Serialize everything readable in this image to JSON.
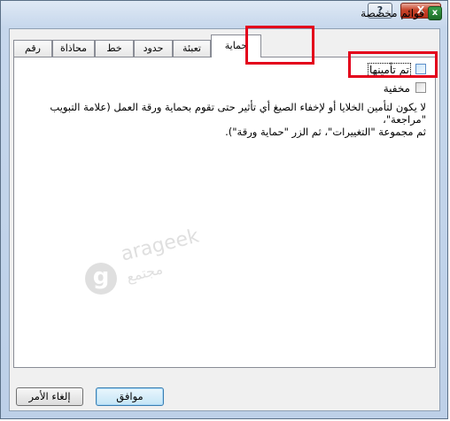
{
  "window": {
    "title": "قوائم مخصصة",
    "help_label": "?",
    "close_label": "X"
  },
  "tabs": [
    {
      "label": "رقم"
    },
    {
      "label": "محاذاة"
    },
    {
      "label": "خط"
    },
    {
      "label": "حدود"
    },
    {
      "label": "تعبئة"
    },
    {
      "label": "حماية",
      "active": true
    }
  ],
  "protection": {
    "locked_label": "تم تأمينها",
    "locked_checked": false,
    "hidden_label": "مخفية",
    "hidden_checked": false,
    "note_line1": "لا يكون لتأمين الخلايا أو لإخفاء الصيغ أي تأثير حتى تقوم بحماية ورقة العمل (علامة التبويب \"مراجعة\"،",
    "note_line2": "ثم مجموعة \"التغييرات\"، ثم الزر \"حماية ورقة\")."
  },
  "watermark": {
    "logo_letter": "g",
    "brand": "arageek",
    "sub": "مجتمع"
  },
  "buttons": {
    "ok_label": "موافق",
    "cancel_label": "إلغاء الأمر"
  },
  "colors": {
    "highlight": "#e3001b",
    "accent": "#3c7fb1"
  }
}
